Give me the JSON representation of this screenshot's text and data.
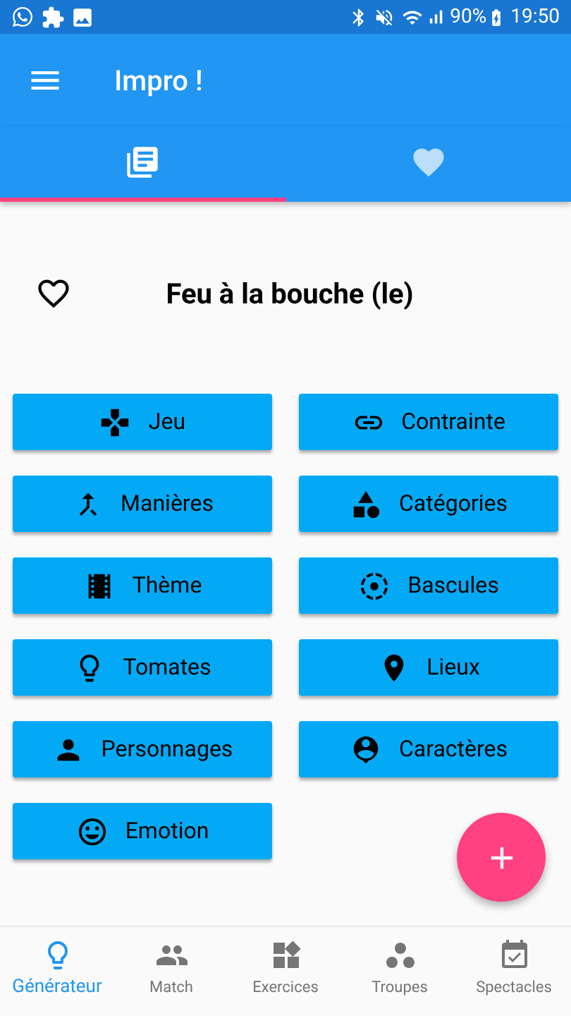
{
  "status_bar": {
    "battery": "90%",
    "time": "19:50"
  },
  "app_bar": {
    "title": "Impro !"
  },
  "tabs": [
    {
      "kind": "list",
      "selected": true
    },
    {
      "kind": "favorites",
      "selected": false
    }
  ],
  "result": {
    "title": "Feu à la bouche (le)",
    "favorite": false
  },
  "generators": [
    {
      "label": "Jeu"
    },
    {
      "label": "Contrainte"
    },
    {
      "label": "Manières"
    },
    {
      "label": "Catégories"
    },
    {
      "label": "Thème"
    },
    {
      "label": "Bascules"
    },
    {
      "label": "Tomates"
    },
    {
      "label": "Lieux"
    },
    {
      "label": "Personnages"
    },
    {
      "label": "Caractères"
    },
    {
      "label": "Emotion"
    }
  ],
  "bottom_nav": [
    {
      "label": "Générateur",
      "selected": true
    },
    {
      "label": "Match",
      "selected": false
    },
    {
      "label": "Exercices",
      "selected": false
    },
    {
      "label": "Troupes",
      "selected": false
    },
    {
      "label": "Spectacles",
      "selected": false
    }
  ]
}
